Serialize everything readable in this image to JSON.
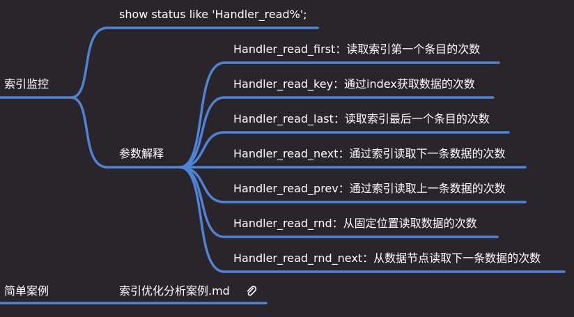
{
  "colors": {
    "background": "#2a252b",
    "branch": "#4e84d6",
    "text": "#ffffff"
  },
  "nodes": {
    "index_monitor": "索引监控",
    "show_status": "show status like 'Handler_read%';",
    "param_explain": "参数解释",
    "params": [
      "Handler_read_first：读取索引第一个条目的次数",
      "Handler_read_key：通过index获取数据的次数",
      "Handler_read_last：读取索引最后一个条目的次数",
      "Handler_read_next：通过索引读取下一条数据的次数",
      "Handler_read_prev：通过索引读取上一条数据的次数",
      "Handler_read_rnd：从固定位置读取数据的次数",
      "Handler_read_rnd_next：从数据节点读取下一条数据的次数"
    ],
    "simple_case": "简单案例",
    "case_file": "索引优化分析案例.md"
  },
  "icons": {
    "attachment": "paperclip-icon"
  }
}
